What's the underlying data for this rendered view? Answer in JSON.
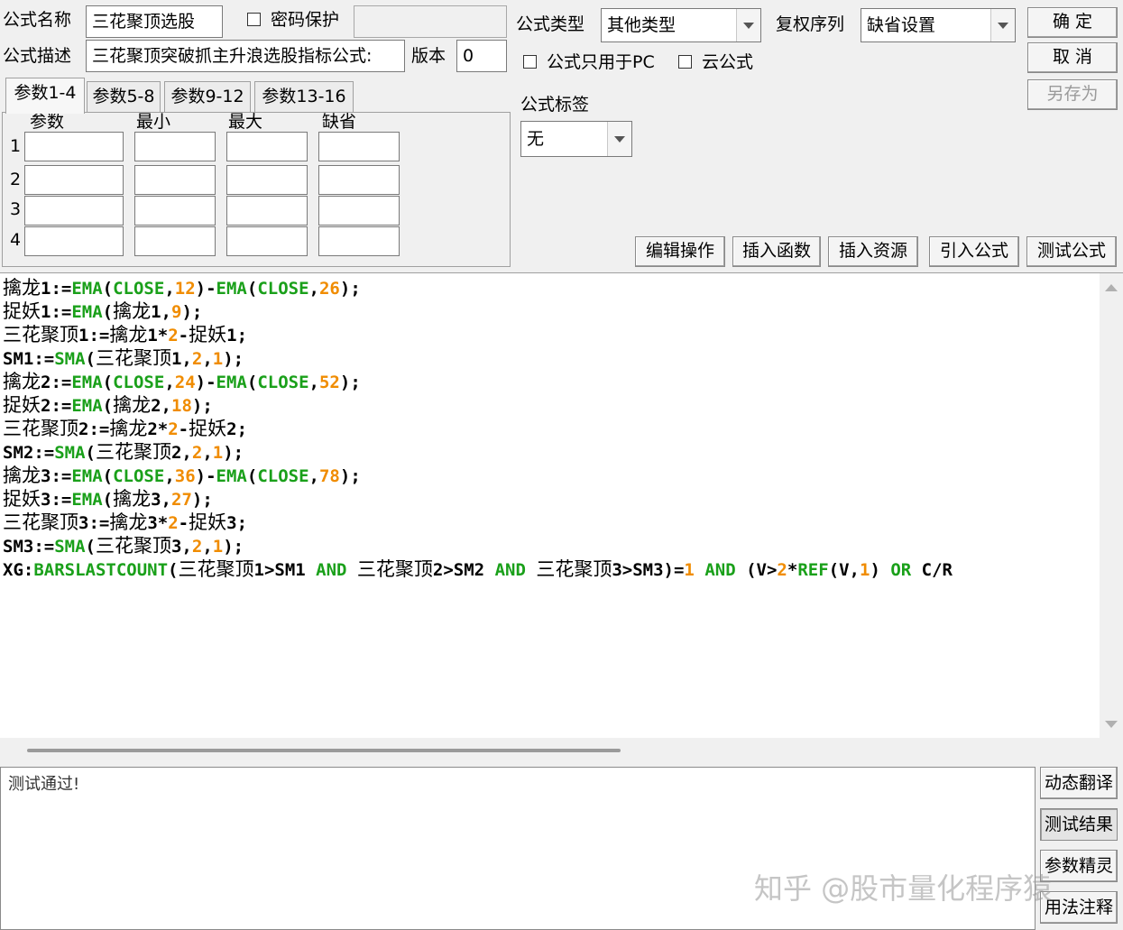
{
  "header": {
    "name_label": "公式名称",
    "name_value": "三花聚顶选股",
    "password_label": "密码保护",
    "password_value": "",
    "desc_label": "公式描述",
    "desc_value": "三花聚顶突破抓主升浪选股指标公式:",
    "version_label": "版本",
    "version_value": "0",
    "type_label": "公式类型",
    "type_value": "其他类型",
    "adjust_label": "复权序列",
    "adjust_value": "缺省设置",
    "pc_only_label": "公式只用于PC",
    "cloud_label": "云公式",
    "tag_label": "公式标签",
    "tag_value": "无"
  },
  "buttons": {
    "ok": "确 定",
    "cancel": "取 消",
    "save_as": "另存为",
    "edit_ops": "编辑操作",
    "insert_func": "插入函数",
    "insert_res": "插入资源",
    "import_formula": "引入公式",
    "test_formula": "测试公式",
    "dyn_translate": "动态翻译",
    "test_result": "测试结果",
    "param_wizard": "参数精灵",
    "usage_notes": "用法注释"
  },
  "params": {
    "tabs": [
      "参数1-4",
      "参数5-8",
      "参数9-12",
      "参数13-16"
    ],
    "headers": [
      "参数",
      "最小",
      "最大",
      "缺省"
    ],
    "rows": [
      "1",
      "2",
      "3",
      "4"
    ]
  },
  "code_lines": [
    [
      [
        "t",
        "擒龙"
      ],
      [
        "p",
        "1:="
      ],
      [
        "k",
        "EMA"
      ],
      [
        "p",
        "("
      ],
      [
        "k",
        "CLOSE"
      ],
      [
        "p",
        ","
      ],
      [
        "n",
        "12"
      ],
      [
        "p",
        ")-"
      ],
      [
        "k",
        "EMA"
      ],
      [
        "p",
        "("
      ],
      [
        "k",
        "CLOSE"
      ],
      [
        "p",
        ","
      ],
      [
        "n",
        "26"
      ],
      [
        "p",
        ");"
      ]
    ],
    [
      [
        "t",
        "捉妖"
      ],
      [
        "p",
        "1:="
      ],
      [
        "k",
        "EMA"
      ],
      [
        "p",
        "("
      ],
      [
        "t",
        "擒龙"
      ],
      [
        "p",
        "1,"
      ],
      [
        "n",
        "9"
      ],
      [
        "p",
        ");"
      ]
    ],
    [
      [
        "t",
        "三花聚顶"
      ],
      [
        "p",
        "1:="
      ],
      [
        "t",
        "擒龙"
      ],
      [
        "p",
        "1*"
      ],
      [
        "n",
        "2"
      ],
      [
        "p",
        "-"
      ],
      [
        "t",
        "捉妖"
      ],
      [
        "p",
        "1;"
      ]
    ],
    [
      [
        "p",
        "SM1:="
      ],
      [
        "k",
        "SMA"
      ],
      [
        "p",
        "("
      ],
      [
        "t",
        "三花聚顶"
      ],
      [
        "p",
        "1,"
      ],
      [
        "n",
        "2"
      ],
      [
        "p",
        ","
      ],
      [
        "n",
        "1"
      ],
      [
        "p",
        ");"
      ]
    ],
    [
      [
        "t",
        "擒龙"
      ],
      [
        "p",
        "2:="
      ],
      [
        "k",
        "EMA"
      ],
      [
        "p",
        "("
      ],
      [
        "k",
        "CLOSE"
      ],
      [
        "p",
        ","
      ],
      [
        "n",
        "24"
      ],
      [
        "p",
        ")-"
      ],
      [
        "k",
        "EMA"
      ],
      [
        "p",
        "("
      ],
      [
        "k",
        "CLOSE"
      ],
      [
        "p",
        ","
      ],
      [
        "n",
        "52"
      ],
      [
        "p",
        ");"
      ]
    ],
    [
      [
        "t",
        "捉妖"
      ],
      [
        "p",
        "2:="
      ],
      [
        "k",
        "EMA"
      ],
      [
        "p",
        "("
      ],
      [
        "t",
        "擒龙"
      ],
      [
        "p",
        "2,"
      ],
      [
        "n",
        "18"
      ],
      [
        "p",
        ");"
      ]
    ],
    [
      [
        "t",
        "三花聚顶"
      ],
      [
        "p",
        "2:="
      ],
      [
        "t",
        "擒龙"
      ],
      [
        "p",
        "2*"
      ],
      [
        "n",
        "2"
      ],
      [
        "p",
        "-"
      ],
      [
        "t",
        "捉妖"
      ],
      [
        "p",
        "2;"
      ]
    ],
    [
      [
        "p",
        "SM2:="
      ],
      [
        "k",
        "SMA"
      ],
      [
        "p",
        "("
      ],
      [
        "t",
        "三花聚顶"
      ],
      [
        "p",
        "2,"
      ],
      [
        "n",
        "2"
      ],
      [
        "p",
        ","
      ],
      [
        "n",
        "1"
      ],
      [
        "p",
        ");"
      ]
    ],
    [
      [
        "t",
        "擒龙"
      ],
      [
        "p",
        "3:="
      ],
      [
        "k",
        "EMA"
      ],
      [
        "p",
        "("
      ],
      [
        "k",
        "CLOSE"
      ],
      [
        "p",
        ","
      ],
      [
        "n",
        "36"
      ],
      [
        "p",
        ")-"
      ],
      [
        "k",
        "EMA"
      ],
      [
        "p",
        "("
      ],
      [
        "k",
        "CLOSE"
      ],
      [
        "p",
        ","
      ],
      [
        "n",
        "78"
      ],
      [
        "p",
        ");"
      ]
    ],
    [
      [
        "t",
        "捉妖"
      ],
      [
        "p",
        "3:="
      ],
      [
        "k",
        "EMA"
      ],
      [
        "p",
        "("
      ],
      [
        "t",
        "擒龙"
      ],
      [
        "p",
        "3,"
      ],
      [
        "n",
        "27"
      ],
      [
        "p",
        ");"
      ]
    ],
    [
      [
        "t",
        "三花聚顶"
      ],
      [
        "p",
        "3:="
      ],
      [
        "t",
        "擒龙"
      ],
      [
        "p",
        "3*"
      ],
      [
        "n",
        "2"
      ],
      [
        "p",
        "-"
      ],
      [
        "t",
        "捉妖"
      ],
      [
        "p",
        "3;"
      ]
    ],
    [
      [
        "p",
        "SM3:="
      ],
      [
        "k",
        "SMA"
      ],
      [
        "p",
        "("
      ],
      [
        "t",
        "三花聚顶"
      ],
      [
        "p",
        "3,"
      ],
      [
        "n",
        "2"
      ],
      [
        "p",
        ","
      ],
      [
        "n",
        "1"
      ],
      [
        "p",
        ");"
      ]
    ],
    [
      [
        "p",
        "XG:"
      ],
      [
        "k",
        "BARSLASTCOUNT"
      ],
      [
        "p",
        "("
      ],
      [
        "t",
        "三花聚顶"
      ],
      [
        "p",
        "1>SM1 "
      ],
      [
        "k",
        "AND"
      ],
      [
        "p",
        " "
      ],
      [
        "t",
        "三花聚顶"
      ],
      [
        "p",
        "2>SM2 "
      ],
      [
        "k",
        "AND"
      ],
      [
        "p",
        " "
      ],
      [
        "t",
        "三花聚顶"
      ],
      [
        "p",
        "3>SM3)="
      ],
      [
        "n",
        "1"
      ],
      [
        "p",
        " "
      ],
      [
        "k",
        "AND"
      ],
      [
        "p",
        " (V>"
      ],
      [
        "n",
        "2"
      ],
      [
        "p",
        "*"
      ],
      [
        "k",
        "REF"
      ],
      [
        "p",
        "(V,"
      ],
      [
        "n",
        "1"
      ],
      [
        "p",
        ") "
      ],
      [
        "k",
        "OR"
      ],
      [
        "p",
        " C/R"
      ]
    ]
  ],
  "output_text": "测试通过!",
  "watermark": "知乎 @股市量化程序猿"
}
